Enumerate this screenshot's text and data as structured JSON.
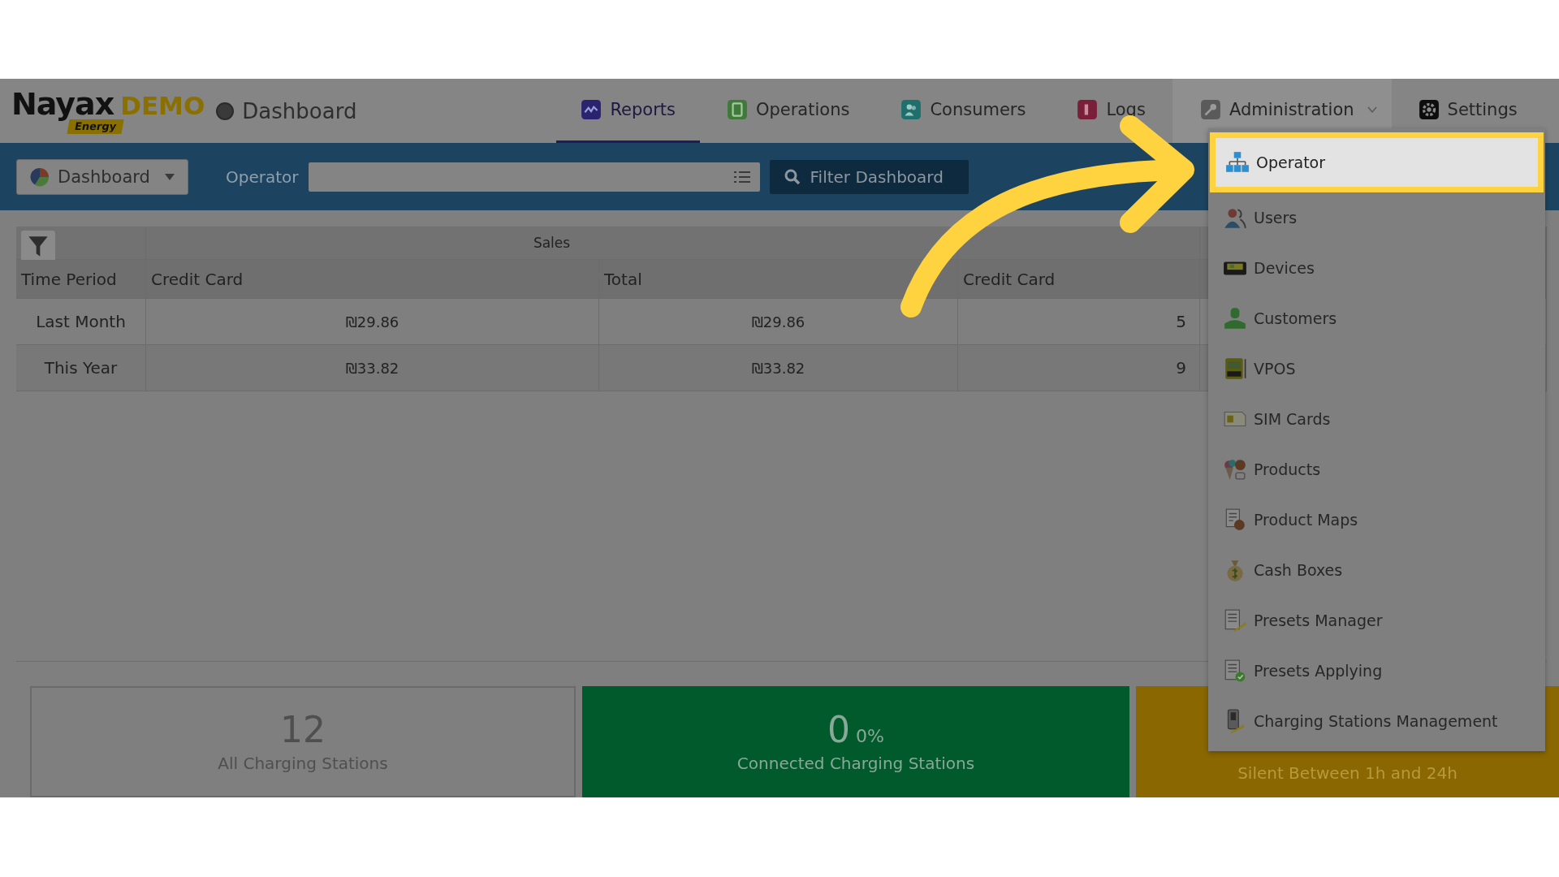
{
  "header": {
    "logo": {
      "brand": "Nayax",
      "edition": "DEMO",
      "badge": "Energy"
    },
    "page_title": "Dashboard"
  },
  "nav_tabs": [
    {
      "label": "Reports",
      "kind": "reports",
      "selected": true,
      "expanded": false
    },
    {
      "label": "Operations",
      "kind": "operations",
      "selected": false,
      "expanded": false
    },
    {
      "label": "Consumers",
      "kind": "consumers",
      "selected": false,
      "expanded": false
    },
    {
      "label": "Logs",
      "kind": "logs",
      "selected": false,
      "expanded": false
    },
    {
      "label": "Administration",
      "kind": "administration",
      "selected": false,
      "expanded": true
    },
    {
      "label": "Settings",
      "kind": "settings",
      "selected": false,
      "expanded": false
    }
  ],
  "toolbar": {
    "view_select": "Dashboard",
    "operator_label": "Operator",
    "filter_button": "Filter Dashboard"
  },
  "table": {
    "group_header": "Sales",
    "columns": [
      "Time Period",
      "Credit Card",
      "Total",
      "Credit Card"
    ],
    "rows": [
      {
        "cells": [
          "Last Month",
          "₪29.86",
          "₪29.86",
          "5"
        ]
      },
      {
        "cells": [
          "This Year",
          "₪33.82",
          "₪33.82",
          "9"
        ]
      }
    ]
  },
  "cards": [
    {
      "kind": "neutral",
      "value": "12",
      "label": "All Charging Stations"
    },
    {
      "kind": "connected",
      "value": "0",
      "percent": "0%",
      "label": "Connected Charging Stations"
    },
    {
      "kind": "silent",
      "label": "Silent Between 1h and 24h"
    }
  ],
  "admin_menu": [
    {
      "label": "Operator",
      "kind": "operator",
      "selected": true
    },
    {
      "label": "Users",
      "kind": "users",
      "selected": false
    },
    {
      "label": "Devices",
      "kind": "devices",
      "selected": false
    },
    {
      "label": "Customers",
      "kind": "customers",
      "selected": false
    },
    {
      "label": "VPOS",
      "kind": "vpos",
      "selected": false
    },
    {
      "label": "SIM Cards",
      "kind": "sim",
      "selected": false
    },
    {
      "label": "Products",
      "kind": "products",
      "selected": false
    },
    {
      "label": "Product Maps",
      "kind": "product-maps",
      "selected": false
    },
    {
      "label": "Cash Boxes",
      "kind": "cash-boxes",
      "selected": false
    },
    {
      "label": "Presets Manager",
      "kind": "presets-manager",
      "selected": false
    },
    {
      "label": "Presets Applying",
      "kind": "presets-applying",
      "selected": false
    },
    {
      "label": "Charging Stations Management",
      "kind": "charging-management",
      "selected": false
    }
  ]
}
